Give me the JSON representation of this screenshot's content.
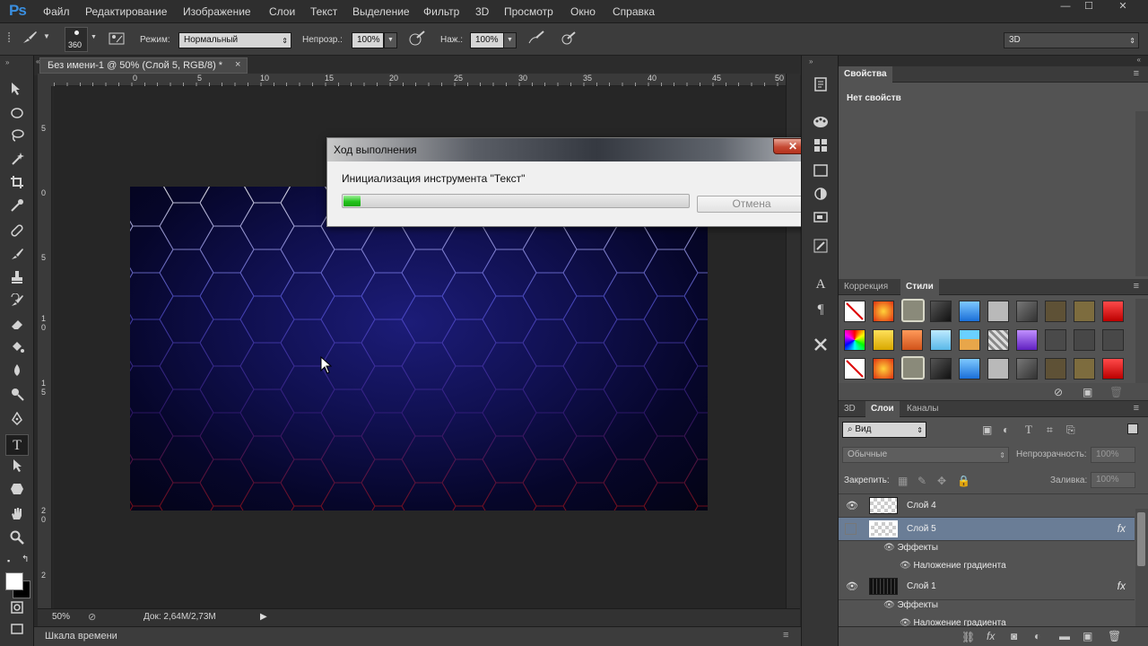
{
  "app": {
    "logo": "Ps"
  },
  "menu": [
    "Файл",
    "Редактирование",
    "Изображение",
    "Слои",
    "Текст",
    "Выделение",
    "Фильтр",
    "3D",
    "Просмотр",
    "Окно",
    "Справка"
  ],
  "window_buttons": {
    "minimize": "—",
    "maximize": "☐",
    "close": "✕"
  },
  "options": {
    "brush_size": "360",
    "mode_label": "Режим:",
    "mode_value": "Нормальный",
    "opacity_label": "Непрозр.:",
    "opacity_value": "100%",
    "flow_label": "Наж.:",
    "flow_value": "100%",
    "workspace": "3D"
  },
  "document": {
    "tab_title": "Без имени-1 @ 50% (Слой 5, RGB/8) *",
    "tab_close": "×",
    "ruler_h": [
      "0",
      "5",
      "10",
      "15",
      "20",
      "25",
      "30",
      "35",
      "40",
      "45",
      "50"
    ],
    "ruler_v": [
      "5",
      "0",
      "5",
      "1",
      "0",
      "1",
      "5",
      "2",
      "0",
      "2"
    ],
    "zoom": "50%",
    "doc_info": "Док: 2,64M/2,73M",
    "timeline": "Шкала времени"
  },
  "dialog": {
    "title": "Ход выполнения",
    "close": "✕",
    "message": "Инициализация инструмента \"Текст\"",
    "progress": 0.05,
    "cancel": "Отмена"
  },
  "panels": {
    "properties_tab": "Свойства",
    "properties_empty": "Нет свойств",
    "adjust_tab": "Коррекция",
    "styles_tab": "Стили",
    "layers_tabs": [
      "3D",
      "Слои",
      "Каналы"
    ],
    "filter_kind": "Вид",
    "blend_mode": "Обычные",
    "opacity_label": "Непрозрачность:",
    "opacity_value": "100%",
    "lock_label": "Закрепить:",
    "fill_label": "Заливка:",
    "fill_value": "100%"
  },
  "layers": [
    {
      "name": "Слой 4",
      "visible": true,
      "selected": false,
      "fx": false
    },
    {
      "name": "Слой 5",
      "visible": false,
      "selected": true,
      "fx": true
    },
    {
      "name": "Слой 1",
      "visible": true,
      "selected": false,
      "fx": true
    }
  ],
  "layer_effects": {
    "effects_label": "Эффекты",
    "gradient_overlay": "Наложение градиента",
    "fx_mark": "fx"
  },
  "colors": {
    "accent": "#3a8fe0",
    "selected_layer": "#6a7d96",
    "progress_green": "#24c41d"
  }
}
